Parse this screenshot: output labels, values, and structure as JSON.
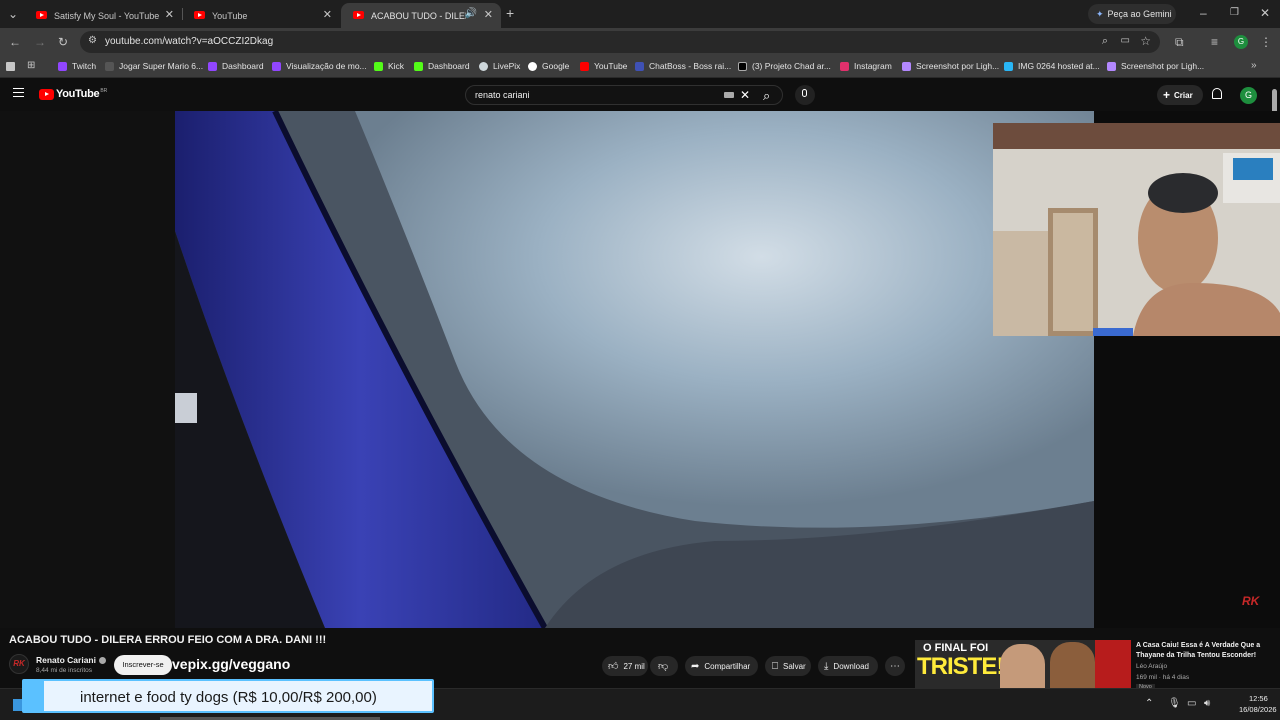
{
  "browser": {
    "tabs": [
      {
        "title": "Satisfy My Soul - YouTube",
        "active": false
      },
      {
        "title": "YouTube",
        "active": false
      },
      {
        "title": "ACABOU TUDO - DILERA E",
        "active": true
      }
    ],
    "gemini_label": "Peça ao Gemini",
    "url": "youtube.com/watch?v=aOCCZI2Dkag",
    "profile_initial": "G",
    "bookmarks": [
      "Twitch",
      "Jogar Super Mario 6...",
      "Dashboard",
      "Visualização de mo...",
      "Kick",
      "Dashboard",
      "LivePix",
      "Google",
      "YouTube",
      "ChatBoss - Boss rai...",
      "(3) Projeto Chad ar...",
      "Instagram",
      "Screenshot por Ligh...",
      "IMG 0264 hosted at...",
      "Screenshot por Ligh..."
    ]
  },
  "youtube": {
    "logo": "YouTube",
    "logo_sup": "BR",
    "search_value": "renato cariani",
    "create_label": "Criar",
    "avatar_initial": "G"
  },
  "video": {
    "title": "ACABOU TUDO - DILERA ERROU FEIO COM A DRA. DANI !!!",
    "channel": "Renato Cariani",
    "subscribers": "8,44 mi de inscritos",
    "subscribe_label": "Inscrever-se",
    "overlay_url": "vepix.gg/veggano",
    "likes": "27 mil",
    "share_label": "Compartilhar",
    "save_label": "Salvar",
    "download_label": "Download",
    "watermark": "RK"
  },
  "recommended": {
    "thumb_text_line1": "O FINAL FOI",
    "thumb_text_line2": "TRISTE!",
    "title": "A Casa Caiu! Essa é A Verdade Que a Thayane da Trilha Tentou Esconder!",
    "channel": "Léo Araújo",
    "meta": "169 mil · há 4 dias",
    "badge": "Novo"
  },
  "donation": {
    "text": "internet e food ty dogs (R$ 10,00/R$ 200,00)"
  },
  "taskbar": {
    "time": "12:56",
    "date": "16/08/2026"
  }
}
